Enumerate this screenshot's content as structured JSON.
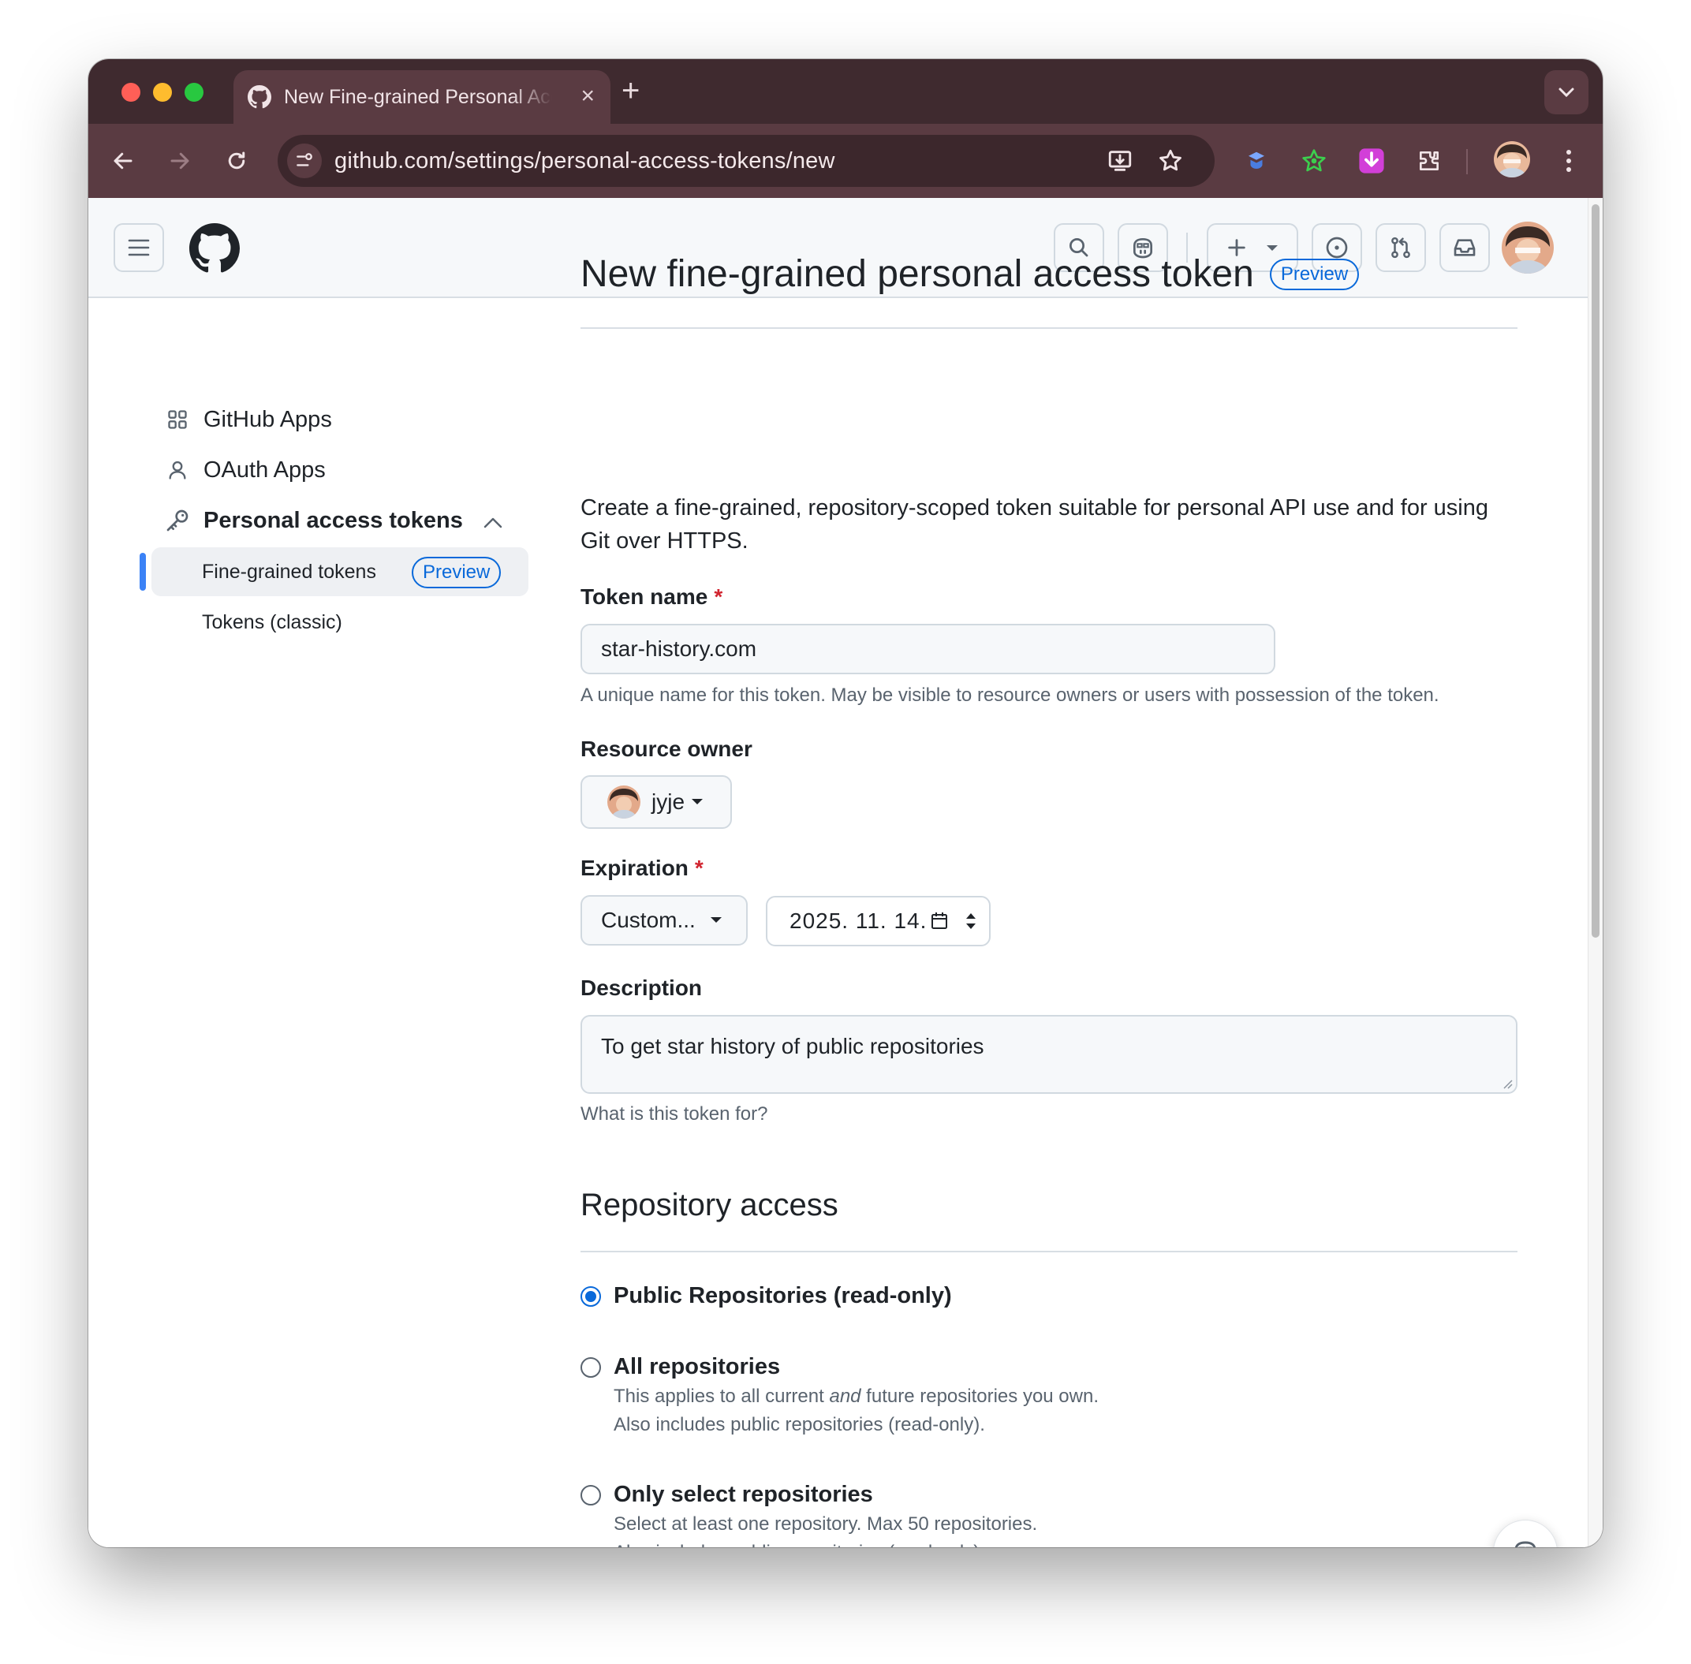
{
  "browser": {
    "tab_title": "New Fine-grained Personal Access Tokens",
    "tab_close": "×",
    "new_tab": "+",
    "url": "github.com/settings/personal-access-tokens/new"
  },
  "sidebar": {
    "github_apps": "GitHub Apps",
    "oauth_apps": "OAuth Apps",
    "personal_access_tokens": "Personal access tokens",
    "fine_grained": "Fine-grained tokens",
    "fine_grained_badge": "Preview",
    "classic": "Tokens (classic)"
  },
  "main": {
    "title": "New fine-grained personal access token",
    "title_badge": "Preview",
    "lead": "Create a fine-grained, repository-scoped token suitable for personal API use and for using Git over HTTPS.",
    "token_name_label": "Token name",
    "required_mark": "*",
    "token_name_value": "star-history.com",
    "token_name_hint": "A unique name for this token. May be visible to resource owners or users with possession of the token.",
    "resource_owner_label": "Resource owner",
    "resource_owner_value": "jyje",
    "expiration_label": "Expiration",
    "expiration_value": "Custom...",
    "expiration_date": "2025. 11. 14.",
    "description_label": "Description",
    "description_value": "To get star history of public repositories",
    "description_hint": "What is this token for?"
  },
  "repo_access": {
    "heading": "Repository access",
    "options": [
      {
        "label": "Public Repositories (read-only)",
        "selected": true,
        "desc": []
      },
      {
        "label": "All repositories",
        "selected": false,
        "desc_pre": "This applies to all current ",
        "desc_em": "and",
        "desc_post": " future repositories you own.",
        "desc2": "Also includes public repositories (read-only)."
      },
      {
        "label": "Only select repositories",
        "selected": false,
        "desc1": "Select at least one repository. Max 50 repositories.",
        "desc2": "Also includes public repositories (read-only)."
      }
    ]
  },
  "colors": {
    "accent": "#0969da",
    "required": "#d1242f",
    "chrome_dark": "#3f2a2f",
    "chrome_toolbar": "#5a3b42"
  }
}
